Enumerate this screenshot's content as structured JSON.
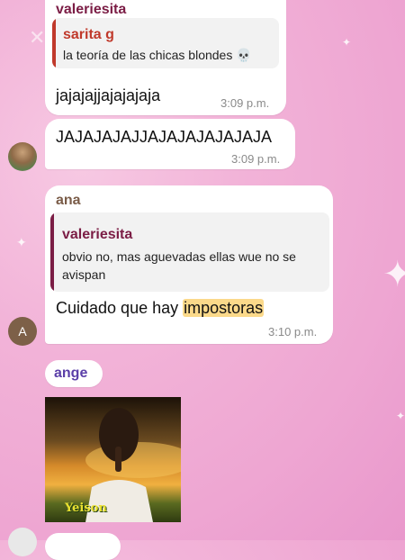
{
  "messages": [
    {
      "sender": "valeriesita",
      "reply": {
        "name": "sarita g",
        "text": "la teoría de las chicas blondes 💀"
      },
      "text": "jajajajjajajajaja",
      "time": "3:09 p.m."
    },
    {
      "text": "JAJAJAJAJJAJAJAJAJAJAJA",
      "time": "3:09 p.m."
    },
    {
      "sender": "ana",
      "reply": {
        "name": "valeriesita",
        "text_line1": "obvio no, mas aguevadas ellas wue no se",
        "text_line2": "avispan"
      },
      "text_before": "Cuidado que hay ",
      "text_highlight": "impostoras",
      "time": "3:10 p.m.",
      "avatar_letter": "A"
    },
    {
      "sender": "ange",
      "image_caption": "Yeison"
    }
  ],
  "colors": {
    "valeriesita": "#7b1d45",
    "sarita": "#c0392b",
    "ana": "#7a5c48",
    "ange": "#5b3fa8",
    "highlight": "#fbd98a"
  }
}
